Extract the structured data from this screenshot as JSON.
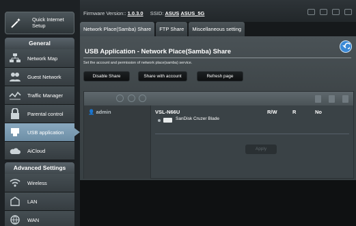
{
  "header": {
    "firmware_label": "Firmware Version::",
    "firmware_value": "1.0.3.0",
    "ssid_label": "SSID:",
    "ssid_1": "ASUS",
    "ssid_2": "ASUS_5G"
  },
  "quick_setup": {
    "label_line1": "Quick Internet",
    "label_line2": "Setup"
  },
  "general": {
    "title": "General",
    "items": [
      {
        "label": "Network Map",
        "icon": "network-map-icon"
      },
      {
        "label": "Guest Network",
        "icon": "guest-network-icon"
      },
      {
        "label": "Traffic Manager",
        "icon": "traffic-manager-icon"
      },
      {
        "label": "Parental control",
        "icon": "parental-control-icon"
      },
      {
        "label": "USB application",
        "icon": "usb-icon",
        "active": true
      },
      {
        "label": "AiCloud",
        "icon": "aicloud-icon"
      }
    ]
  },
  "advanced": {
    "title": "Advanced Settings",
    "items": [
      {
        "label": "Wireless",
        "icon": "wireless-icon"
      },
      {
        "label": "LAN",
        "icon": "lan-icon"
      },
      {
        "label": "WAN",
        "icon": "wan-icon"
      }
    ]
  },
  "tabs": [
    "Network Place(Samba) Share",
    "FTP Share",
    "Miscellaneous setting"
  ],
  "page": {
    "title": "USB Application - Network Place(Samba) Share",
    "description": "Set the account and permission of network place(samba) service.",
    "buttons": [
      "Disable Share",
      "Share with account",
      "Refresh page"
    ]
  },
  "share_table": {
    "user": "admin",
    "device": "VSL-N66U",
    "col_rw": "R/W",
    "col_r": "R",
    "col_no": "No",
    "folder": "SanDisk Cruzer Blade",
    "apply_label": "Apply"
  }
}
